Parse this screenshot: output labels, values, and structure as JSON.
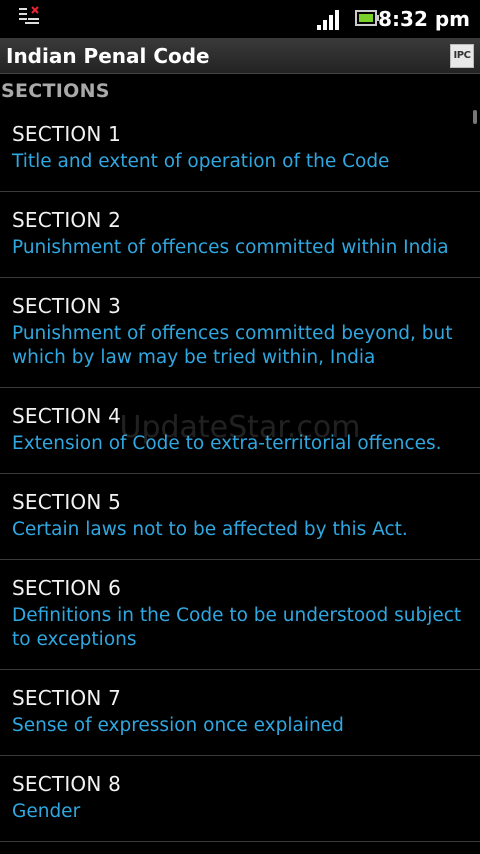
{
  "status_bar": {
    "notification_icon": "list-x-icon",
    "signal_icon": "signal-bars-icon",
    "battery_icon": "battery-icon",
    "time": "8:32 pm"
  },
  "app_bar": {
    "title": "Indian Penal Code",
    "logo_text": "IPC"
  },
  "list": {
    "header": "SECTIONS",
    "items": [
      {
        "title": "SECTION 1",
        "description": "Title and extent of operation of the Code"
      },
      {
        "title": "SECTION 2",
        "description": "Punishment of offences committed within India"
      },
      {
        "title": "SECTION 3",
        "description": "Punishment of offences committed beyond, but which by law may be tried within, India"
      },
      {
        "title": "SECTION 4",
        "description": "Extension of Code to extra-territorial offences."
      },
      {
        "title": "SECTION 5",
        "description": "Certain laws not to be affected by this Act."
      },
      {
        "title": "SECTION 6",
        "description": "Definitions in the Code to be understood subject to exceptions"
      },
      {
        "title": "SECTION 7",
        "description": "Sense of expression once explained"
      },
      {
        "title": "SECTION 8",
        "description": "Gender"
      }
    ]
  },
  "watermark": "UpdateStar.com",
  "colors": {
    "description_text": "#2fa7e0",
    "header_text": "#a9a9a9",
    "background": "#000000"
  }
}
